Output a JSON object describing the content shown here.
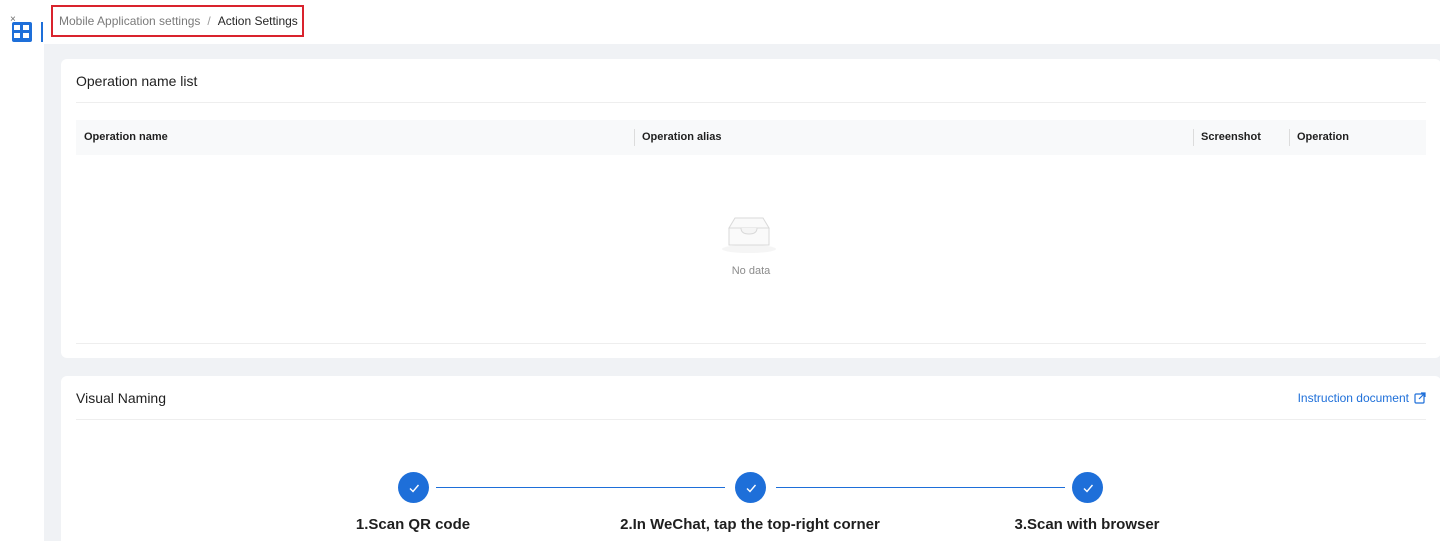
{
  "app": {
    "logo_icon": "app-grid-logo-icon",
    "close_glyph": "×"
  },
  "breadcrumb": {
    "parent": "Mobile Application settings",
    "separator": "/",
    "current": "Action Settings"
  },
  "operation_list": {
    "title": "Operation name list",
    "columns": [
      "Operation name",
      "Operation alias",
      "Screenshot",
      "Operation"
    ],
    "rows": [],
    "empty_icon": "empty-inbox-icon",
    "empty_text": "No data"
  },
  "visual_naming": {
    "title": "Visual Naming",
    "doc_link": "Instruction document",
    "doc_link_icon": "external-link-icon",
    "steps": [
      {
        "label": "1.Scan QR code",
        "status": "done",
        "icon": "check-icon"
      },
      {
        "label": "2.In WeChat, tap the top-right corner",
        "status": "done",
        "icon": "check-icon"
      },
      {
        "label": "3.Scan with browser",
        "status": "done",
        "icon": "check-icon"
      }
    ]
  },
  "colors": {
    "accent": "#1e6fd9",
    "highlight_border": "#d9232d",
    "background": "#f0f2f5"
  }
}
